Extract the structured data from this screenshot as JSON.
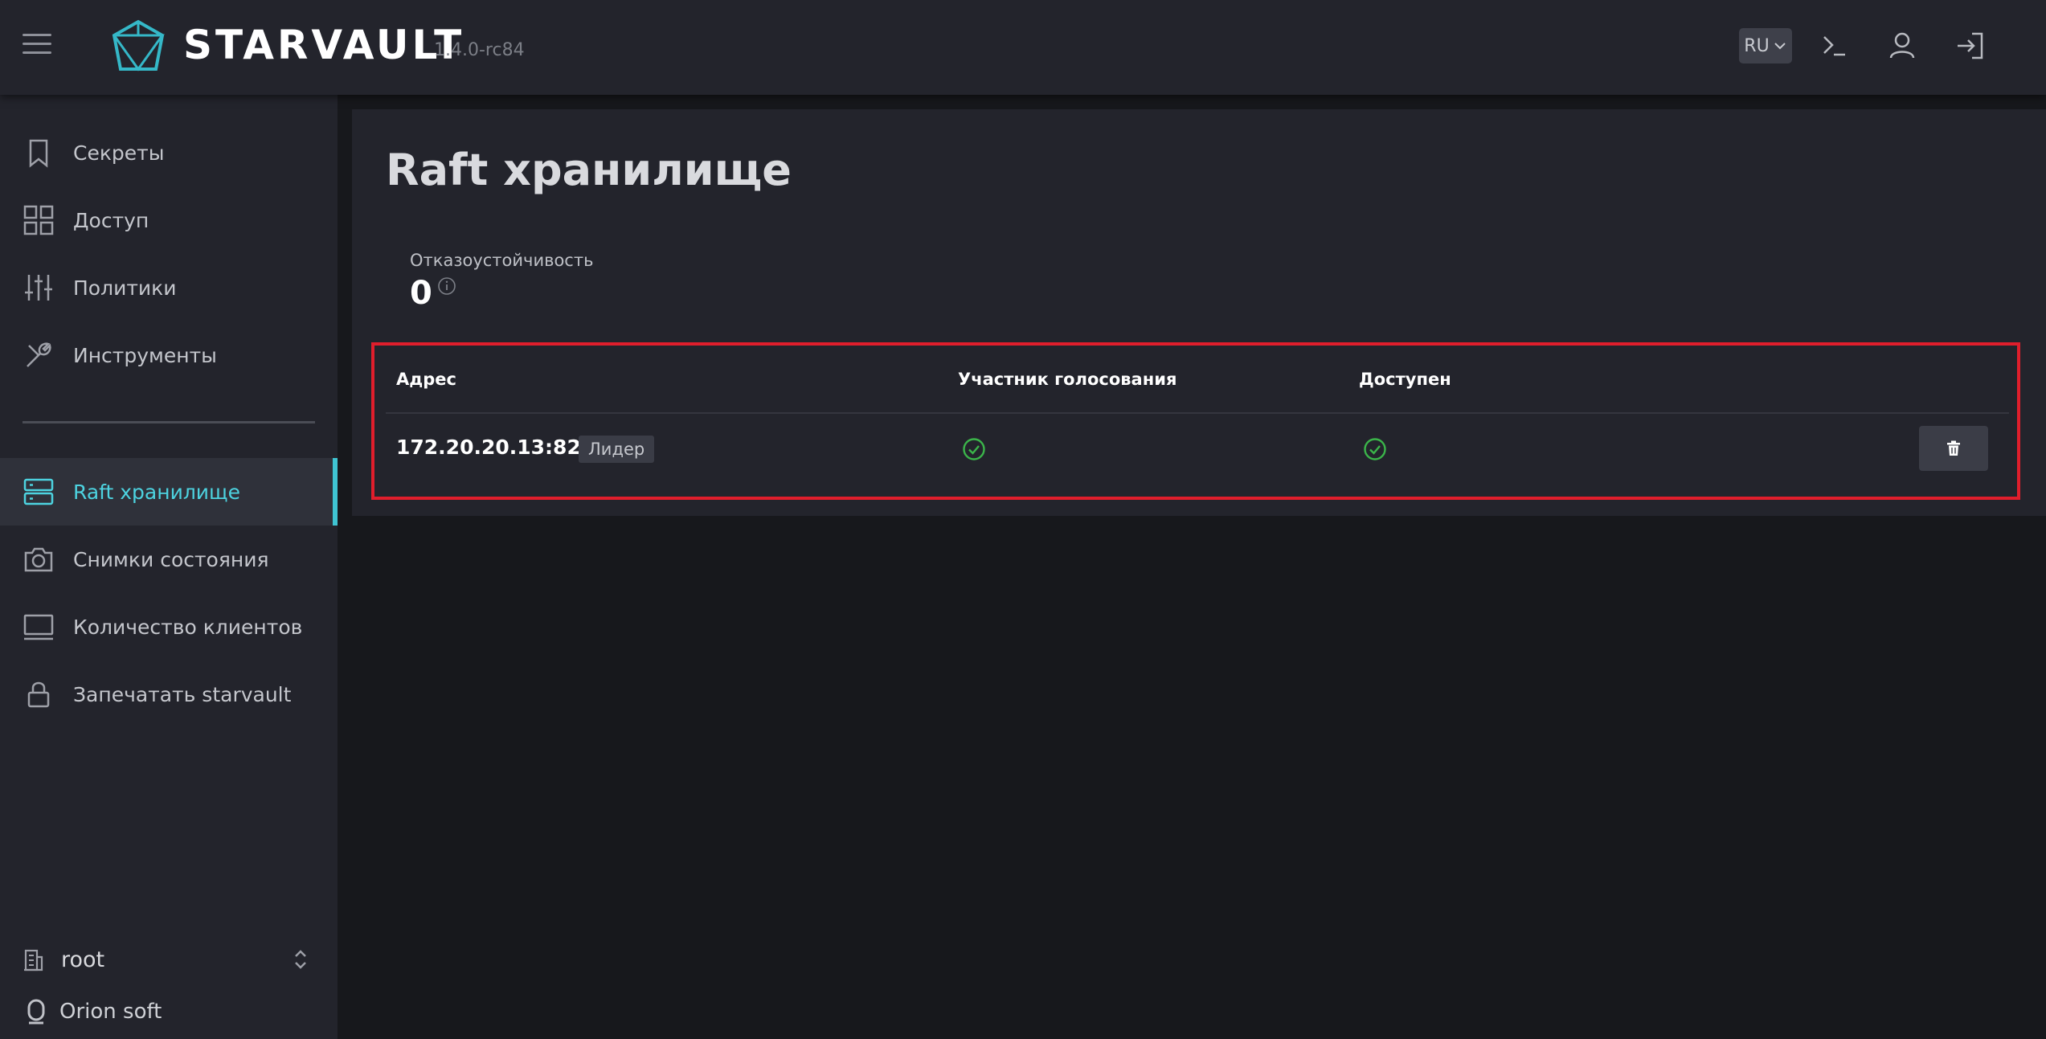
{
  "header": {
    "brand": "STARVAULT",
    "version": "1.4.0-rc84",
    "language": "RU",
    "icons": [
      "menu-icon",
      "starvault-logo-icon",
      "terminal-icon",
      "user-icon",
      "logout-icon"
    ]
  },
  "sidebar": {
    "items": [
      {
        "label": "Секреты",
        "icon": "bookmark-icon"
      },
      {
        "label": "Доступ",
        "icon": "grid-icon"
      },
      {
        "label": "Политики",
        "icon": "sliders-icon"
      },
      {
        "label": "Инструменты",
        "icon": "tools-icon"
      },
      {
        "label": "Raft хранилище",
        "icon": "server-icon",
        "active": true
      },
      {
        "label": "Снимки состояния",
        "icon": "camera-icon"
      },
      {
        "label": "Количество клиентов",
        "icon": "monitor-icon"
      },
      {
        "label": "Запечатать starvault",
        "icon": "lock-icon"
      }
    ],
    "namespace": "root",
    "organization": "Orion soft"
  },
  "main": {
    "title": "Raft хранилище",
    "fault_tolerance_label": "Отказоустойчивость",
    "fault_tolerance_value": "0",
    "table": {
      "headers": [
        "Адрес",
        "Участник голосования",
        "Доступен"
      ],
      "rows": [
        {
          "address": "172.20.20.13:8201",
          "badge": "Лидер",
          "voter": true,
          "healthy": true
        }
      ]
    }
  },
  "colors": {
    "accent": "#3fc4d2",
    "success": "#3bb54a",
    "highlight_border": "#e01e2c",
    "header_bg": "#23242c",
    "page_bg": "#17181c"
  }
}
